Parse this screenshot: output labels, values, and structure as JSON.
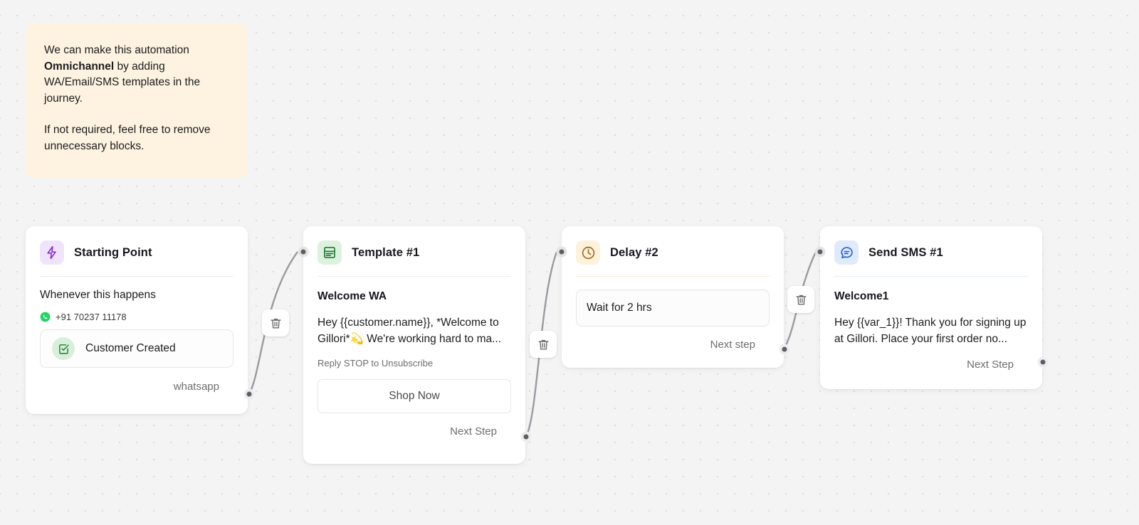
{
  "note": {
    "paragraph1_prefix": "We can make this automation ",
    "paragraph1_bold": "Omnichannel",
    "paragraph1_suffix": " by adding WA/Email/SMS templates in the journey.",
    "paragraph2": "If not required, feel free to remove unnecessary blocks."
  },
  "nodes": {
    "start": {
      "title": "Starting Point",
      "icon": "lightning-bolt-icon",
      "accent": "#8b2fd6",
      "badge_bg": "#f0e4fd",
      "subtitle": "Whenever this happens",
      "phone": "+91 70237 11178",
      "phone_icon": "whatsapp-icon",
      "trigger_chip": "Customer Created",
      "trigger_icon": "checkbox-check-icon",
      "output_label": "whatsapp"
    },
    "template": {
      "title": "Template #1",
      "icon": "template-icon",
      "accent": "#1f7a34",
      "badge_bg": "#ddf2de",
      "message_title": "Welcome WA",
      "message_body_pre": "Hey {{customer.name}}, *Welcome to Gillori*",
      "message_emoji": "💫",
      "message_body_post": " We're working hard to ma...",
      "footer_note": "Reply STOP to Unsubscribe",
      "cta_label": "Shop Now",
      "output_label": "Next Step"
    },
    "delay": {
      "title": "Delay #2",
      "icon": "clock-icon",
      "accent": "#a56b15",
      "badge_bg": "#fdf2dc",
      "wait_value": "Wait for 2 hrs",
      "output_label": "Next step"
    },
    "sms": {
      "title": "Send SMS #1",
      "icon": "sms-bubble-icon",
      "accent": "#2563d8",
      "badge_bg": "#dfeafd",
      "message_title": "Welcome1",
      "message_body": "Hey {{var_1}}! Thank you for signing up at Gillori. Place your first order no...",
      "output_label": "Next Step"
    }
  },
  "controls": {
    "delete_icon": "trash-icon",
    "delete_label": "Delete connection"
  }
}
